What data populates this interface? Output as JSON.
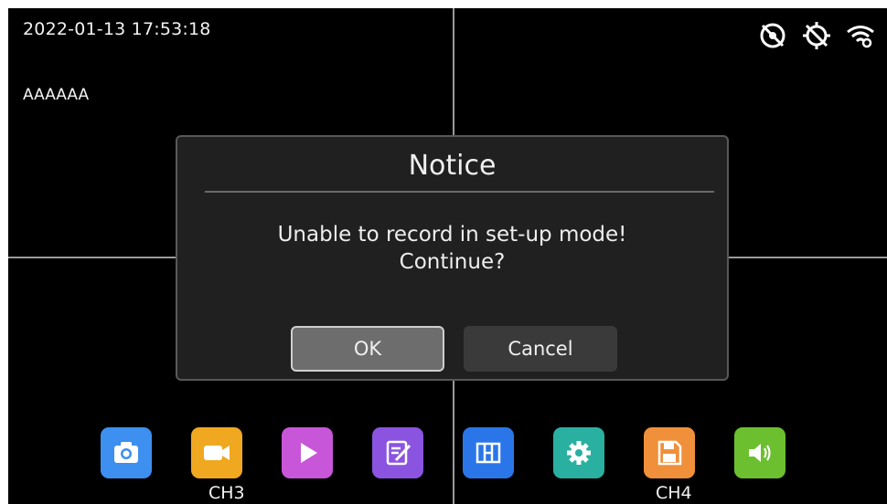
{
  "status_bar": {
    "datetime": "2022-01-13 17:53:18",
    "osd_name": "AAAAAA",
    "icons": [
      "gps-off-icon",
      "sync-off-icon",
      "wifi-icon"
    ]
  },
  "channels": {
    "bottom_left": "CH3",
    "bottom_right": "CH4"
  },
  "dialog": {
    "title": "Notice",
    "message_line1": "Unable to record in set-up mode!",
    "message_line2": "Continue?",
    "ok_label": "OK",
    "cancel_label": "Cancel"
  },
  "dock": [
    {
      "name": "camera-icon",
      "color": "#3d8ff0"
    },
    {
      "name": "video-record-icon",
      "color": "#f0a820"
    },
    {
      "name": "playback-icon",
      "color": "#c856d8"
    },
    {
      "name": "notes-icon",
      "color": "#8a54e0"
    },
    {
      "name": "layout-icon",
      "color": "#2a76e8"
    },
    {
      "name": "settings-icon",
      "color": "#2ab0a0"
    },
    {
      "name": "storage-icon",
      "color": "#f0903a"
    },
    {
      "name": "volume-icon",
      "color": "#6cc030"
    }
  ]
}
